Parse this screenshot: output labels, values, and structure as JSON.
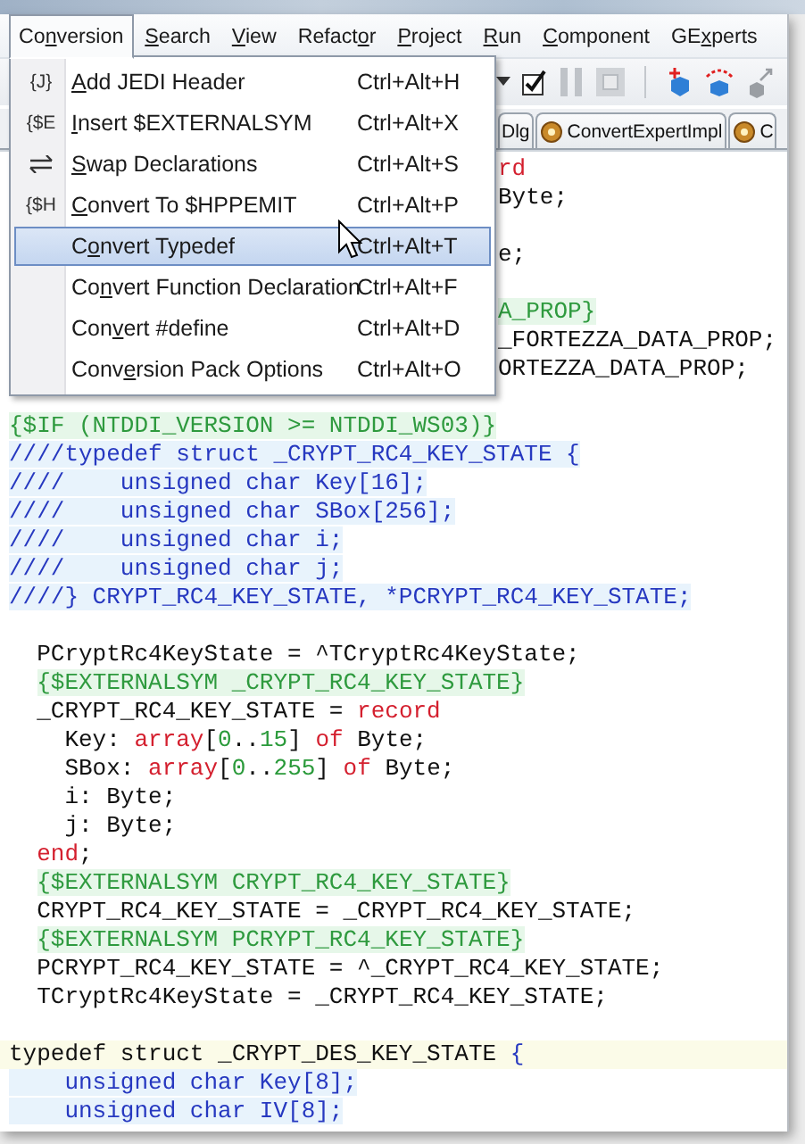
{
  "menu_bar": [
    {
      "label": [
        {
          "text": "Co",
          "underline": false
        },
        {
          "text": "n",
          "underline": true
        },
        {
          "text": "version",
          "underline": false
        }
      ],
      "selected": true
    },
    {
      "label": [
        {
          "text": "S",
          "underline": true
        },
        {
          "text": "earch",
          "underline": false
        }
      ],
      "selected": false
    },
    {
      "label": [
        {
          "text": "V",
          "underline": true
        },
        {
          "text": "iew",
          "underline": false
        }
      ],
      "selected": false
    },
    {
      "label": [
        {
          "text": "Refact",
          "underline": false
        },
        {
          "text": "o",
          "underline": true
        },
        {
          "text": "r",
          "underline": false
        }
      ],
      "selected": false
    },
    {
      "label": [
        {
          "text": "P",
          "underline": true
        },
        {
          "text": "roject",
          "underline": false
        }
      ],
      "selected": false
    },
    {
      "label": [
        {
          "text": "R",
          "underline": true
        },
        {
          "text": "un",
          "underline": false
        }
      ],
      "selected": false
    },
    {
      "label": [
        {
          "text": "C",
          "underline": true
        },
        {
          "text": "omponent",
          "underline": false
        }
      ],
      "selected": false
    },
    {
      "label": [
        {
          "text": "GE",
          "underline": false
        },
        {
          "text": "x",
          "underline": true
        },
        {
          "text": "perts",
          "underline": false
        }
      ],
      "selected": false
    }
  ],
  "menu": [
    {
      "icon": {
        "kind": "text",
        "text": "{J}"
      },
      "label": [
        {
          "text": "A",
          "underline": true
        },
        {
          "text": "dd JEDI Header",
          "underline": false
        }
      ],
      "shortcut": "Ctrl+Alt+H",
      "selected": false
    },
    {
      "icon": {
        "kind": "text",
        "text": "{$E"
      },
      "label": [
        {
          "text": "I",
          "underline": true
        },
        {
          "text": "nsert $EXTERNALSYM",
          "underline": false
        }
      ],
      "shortcut": "Ctrl+Alt+X",
      "selected": false
    },
    {
      "icon": {
        "kind": "arrows"
      },
      "label": [
        {
          "text": "S",
          "underline": true
        },
        {
          "text": "wap Declarations",
          "underline": false
        }
      ],
      "shortcut": "Ctrl+Alt+S",
      "selected": false
    },
    {
      "icon": {
        "kind": "text",
        "text": "{$H"
      },
      "label": [
        {
          "text": "C",
          "underline": true
        },
        {
          "text": "onvert To $HPPEMIT",
          "underline": false
        }
      ],
      "shortcut": "Ctrl+Alt+P",
      "selected": false
    },
    {
      "label": [
        {
          "text": "C",
          "underline": false
        },
        {
          "text": "o",
          "underline": true
        },
        {
          "text": "nvert Typedef",
          "underline": false
        }
      ],
      "shortcut": "Ctrl+Alt+T",
      "selected": true
    },
    {
      "label": [
        {
          "text": "Co",
          "underline": false
        },
        {
          "text": "n",
          "underline": true
        },
        {
          "text": "vert Function Declaration",
          "underline": false
        }
      ],
      "shortcut": "Ctrl+Alt+F",
      "selected": false
    },
    {
      "label": [
        {
          "text": "Con",
          "underline": false
        },
        {
          "text": "v",
          "underline": true
        },
        {
          "text": "ert #define",
          "underline": false
        }
      ],
      "shortcut": "Ctrl+Alt+D",
      "selected": false
    },
    {
      "label": [
        {
          "text": "Conv",
          "underline": false
        },
        {
          "text": "e",
          "underline": true
        },
        {
          "text": "rsion Pack Options",
          "underline": false
        }
      ],
      "shortcut": "Ctrl+Alt+O",
      "selected": false
    }
  ],
  "tabs": [
    {
      "label": "Dlg",
      "icon": false
    },
    {
      "label": "ConvertExpertImpl",
      "icon": true
    },
    {
      "label": "C",
      "icon": true
    }
  ],
  "code": [
    {
      "covered": true,
      "current": false,
      "spans": [
        {
          "text": "rd",
          "kind": "keyword"
        }
      ]
    },
    {
      "covered": true,
      "current": false,
      "spans": [
        {
          "text": "Byte;",
          "kind": "plain"
        }
      ]
    },
    {
      "current": false
    },
    {
      "covered": true,
      "current": false,
      "spans": [
        {
          "text": "e;",
          "kind": "plain"
        }
      ]
    },
    {
      "current": false
    },
    {
      "covered": true,
      "current": false,
      "spans": [
        {
          "text": "A_PROP}",
          "kind": "directive"
        }
      ]
    },
    {
      "covered": true,
      "current": false,
      "spans": [
        {
          "text": "_FORTEZZA_DATA_PROP;",
          "kind": "plain"
        }
      ]
    },
    {
      "covered": true,
      "current": false,
      "spans": [
        {
          "text": "ORTEZZA_DATA_PROP;",
          "kind": "plain"
        }
      ]
    },
    {
      "current": false
    },
    {
      "covered": false,
      "current": false,
      "spans": [
        {
          "text": "{$IF (NTDDI_VERSION >= NTDDI_WS03)}",
          "kind": "directive"
        }
      ]
    },
    {
      "covered": false,
      "current": false,
      "spans": [
        {
          "text": "////typedef struct _CRYPT_RC4_KEY_STATE {",
          "kind": "comment"
        }
      ]
    },
    {
      "covered": false,
      "current": false,
      "spans": [
        {
          "text": "////    unsigned char Key[16];",
          "kind": "comment"
        }
      ]
    },
    {
      "covered": false,
      "current": false,
      "spans": [
        {
          "text": "////    unsigned char SBox[256];",
          "kind": "comment"
        }
      ]
    },
    {
      "covered": false,
      "current": false,
      "spans": [
        {
          "text": "////    unsigned char i;",
          "kind": "comment"
        }
      ]
    },
    {
      "covered": false,
      "current": false,
      "spans": [
        {
          "text": "////    unsigned char j;",
          "kind": "comment"
        }
      ]
    },
    {
      "covered": false,
      "current": false,
      "spans": [
        {
          "text": "////} CRYPT_RC4_KEY_STATE, *PCRYPT_RC4_KEY_STATE;",
          "kind": "comment"
        }
      ]
    },
    {
      "current": false
    },
    {
      "covered": false,
      "current": false,
      "spans": [
        {
          "text": "  PCryptRc4KeyState = ^TCryptRc4KeyState;",
          "kind": "plain"
        }
      ]
    },
    {
      "covered": false,
      "current": false,
      "spans": [
        {
          "text": "  {$EXTERNALSYM _CRYPT_RC4_KEY_STATE}",
          "kind": "directive"
        }
      ]
    },
    {
      "covered": false,
      "current": false,
      "spans": [
        {
          "text": "  _CRYPT_RC4_KEY_STATE = ",
          "kind": "plain"
        },
        {
          "text": "record",
          "kind": "keyword"
        }
      ]
    },
    {
      "covered": false,
      "current": false,
      "spans": [
        {
          "text": "    Key: ",
          "kind": "plain"
        },
        {
          "text": "array",
          "kind": "keyword"
        },
        {
          "text": "[",
          "kind": "plain"
        },
        {
          "text": "0",
          "kind": "number"
        },
        {
          "text": "..",
          "kind": "plain"
        },
        {
          "text": "15",
          "kind": "number"
        },
        {
          "text": "] ",
          "kind": "plain"
        },
        {
          "text": "of",
          "kind": "keyword"
        },
        {
          "text": " Byte;",
          "kind": "plain"
        }
      ]
    },
    {
      "covered": false,
      "current": false,
      "spans": [
        {
          "text": "    SBox: ",
          "kind": "plain"
        },
        {
          "text": "array",
          "kind": "keyword"
        },
        {
          "text": "[",
          "kind": "plain"
        },
        {
          "text": "0",
          "kind": "number"
        },
        {
          "text": "..",
          "kind": "plain"
        },
        {
          "text": "255",
          "kind": "number"
        },
        {
          "text": "] ",
          "kind": "plain"
        },
        {
          "text": "of",
          "kind": "keyword"
        },
        {
          "text": " Byte;",
          "kind": "plain"
        }
      ]
    },
    {
      "covered": false,
      "current": false,
      "spans": [
        {
          "text": "    i: Byte;",
          "kind": "plain"
        }
      ]
    },
    {
      "covered": false,
      "current": false,
      "spans": [
        {
          "text": "    j: Byte;",
          "kind": "plain"
        }
      ]
    },
    {
      "covered": false,
      "current": false,
      "spans": [
        {
          "text": "  end",
          "kind": "keyword"
        },
        {
          "text": ";",
          "kind": "plain"
        }
      ]
    },
    {
      "covered": false,
      "current": false,
      "spans": [
        {
          "text": "  {$EXTERNALSYM CRYPT_RC4_KEY_STATE}",
          "kind": "directive"
        }
      ]
    },
    {
      "covered": false,
      "current": false,
      "spans": [
        {
          "text": "  CRYPT_RC4_KEY_STATE = _CRYPT_RC4_KEY_STATE;",
          "kind": "plain"
        }
      ]
    },
    {
      "covered": false,
      "current": false,
      "spans": [
        {
          "text": "  {$EXTERNALSYM PCRYPT_RC4_KEY_STATE}",
          "kind": "directive"
        }
      ]
    },
    {
      "covered": false,
      "current": false,
      "spans": [
        {
          "text": "  PCRYPT_RC4_KEY_STATE = ^_CRYPT_RC4_KEY_STATE;",
          "kind": "plain"
        }
      ]
    },
    {
      "covered": false,
      "current": false,
      "spans": [
        {
          "text": "  TCryptRc4KeyState = _CRYPT_RC4_KEY_STATE;",
          "kind": "plain"
        }
      ]
    },
    {
      "current": false
    },
    {
      "covered": false,
      "current": true,
      "spans": [
        {
          "text": "typedef struct _CRYPT_DES_KEY_STATE ",
          "kind": "plain"
        },
        {
          "text": "{",
          "kind": "symbol"
        }
      ]
    },
    {
      "covered": false,
      "current": false,
      "spans": [
        {
          "text": "    unsigned char Key[8];",
          "kind": "comment"
        }
      ]
    },
    {
      "covered": false,
      "current": false,
      "spans": [
        {
          "text": "    unsigned char IV[8];",
          "kind": "comment"
        }
      ]
    }
  ]
}
